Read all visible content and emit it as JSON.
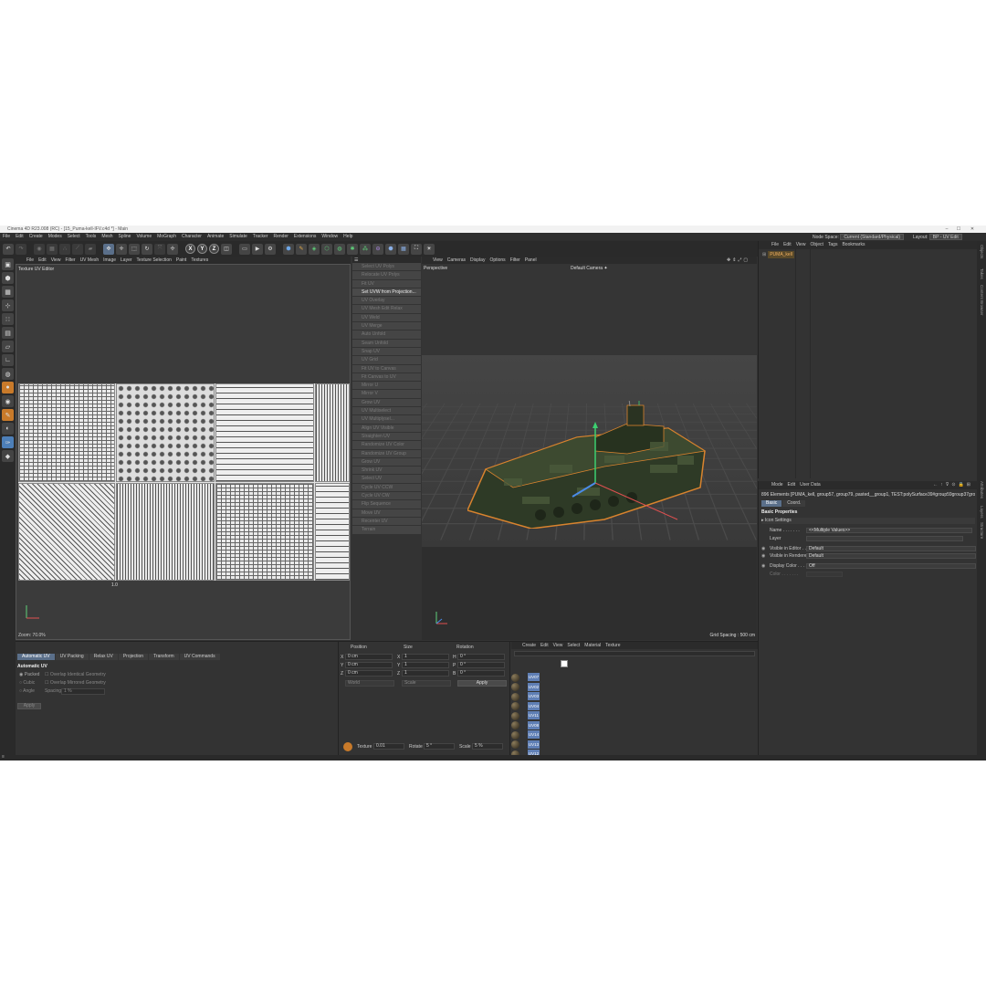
{
  "title": "Cinema 4D R23.008 (RC) - [15_Puma-kell-IFV.c4d *] - Main",
  "window_controls": [
    "–",
    "☐",
    "✕"
  ],
  "menu": [
    "File",
    "Edit",
    "Create",
    "Modes",
    "Select",
    "Tools",
    "Mesh",
    "Spline",
    "Volume",
    "MoGraph",
    "Character",
    "Animate",
    "Simulate",
    "Tracker",
    "Render",
    "Extensions",
    "Window",
    "Help"
  ],
  "node_space_label": "Node Space:",
  "node_space_value": "Current (Standard/Physical)",
  "layout_label": "Layout:",
  "layout_value": "BP - UV Edit",
  "uv_menu": [
    "File",
    "Edit",
    "View",
    "Filter",
    "UV Mesh",
    "Image",
    "Layer",
    "Texture Selection",
    "Paint",
    "Textures"
  ],
  "uv_title": "Texture UV Editor",
  "uv_zoom": "Zoom: 70.0%",
  "uv_one": "1.0",
  "uv_commands": [
    "Select UV Polys",
    "Relocate UV Polys",
    "Fit UV",
    "Set UVW from Projection...",
    "UV Overlay",
    "UV Mesh Edit Relax",
    "UV Weld",
    "UV Merge",
    "Auto Unfold",
    "Seam Unfold",
    "Snap UV",
    "UV Grid",
    "Fit UV to Canvas",
    "Fit Canvas to UV",
    "Mirror U",
    "Mirror V",
    "Grow UV",
    "UV Multiselect",
    "UV Multiplysel...",
    "Align UV Visible",
    "Straighten UV",
    "Randomize UV Color",
    "Randomize UV Group",
    "Grow UV",
    "Shrink UV",
    "Select UV",
    "Cycle UV CCW",
    "Cycle UV CW",
    "Flip Sequence",
    "Move UV",
    "Recenter UV",
    "Terrain"
  ],
  "uv_commands_active_index": 3,
  "viewport_menu": [
    "View",
    "Cameras",
    "Display",
    "Options",
    "Filter",
    "Panel"
  ],
  "viewport_label": "Perspective",
  "camera_label": "Default Camera ✦",
  "grid_spacing": "Grid Spacing : 500 cm",
  "objects_menu": [
    "File",
    "Edit",
    "View",
    "Object",
    "Tags",
    "Bookmarks"
  ],
  "object_name": "PUMA_kell",
  "side_tabs": [
    "Objects",
    "Takes",
    "Content Browser"
  ],
  "side_tabs_lower": [
    "Attributes",
    "Layers",
    "Structure"
  ],
  "attr_menu": [
    "Mode",
    "Edit",
    "User Data"
  ],
  "attr_elements": "896 Elements [PUMA_kell, group57, group79, pasted__group1, TEST:polySurface39#group59group37group16...",
  "attr_tabs": [
    "Basic",
    "Coord."
  ],
  "basic_properties": "Basic Properties",
  "icon_settings": "▸ Icon Settings",
  "attr_rows": [
    {
      "label": "Name . . . . . . .",
      "value": "<<Multiple Values>>"
    },
    {
      "label": "Layer",
      "value": ""
    },
    {
      "label": "Visible in Editor . .",
      "value": "Default"
    },
    {
      "label": "Visible in Renderer",
      "value": "Default"
    },
    {
      "label": "Display Color . . . .",
      "value": "Off"
    },
    {
      "label": "Color . . . . . . .",
      "value": ""
    }
  ],
  "bottom_tabs": [
    "Automatic UV",
    "UV Packing",
    "Relax UV",
    "Projection",
    "Transform",
    "UV Commands"
  ],
  "auto_uv_title": "Automatic UV",
  "auto_uv_opts": [
    "Packed",
    "Cubic",
    "Angle"
  ],
  "auto_uv_checks": [
    "Overlap Identical Geometry",
    "Overlap Mirrored Geometry"
  ],
  "spacing_label": "Spacing",
  "spacing_value": "1 %",
  "apply_label": "Apply",
  "coord_headers": [
    "Position",
    "Size",
    "Rotation"
  ],
  "coord_rows": [
    {
      "axis": "X",
      "pos": "0 cm",
      "size": "1",
      "rot_axis": "H",
      "rot": "0 °"
    },
    {
      "axis": "Y",
      "pos": "0 cm",
      "size": "1",
      "rot_axis": "P",
      "rot": "0 °"
    },
    {
      "axis": "Z",
      "pos": "0 cm",
      "size": "1",
      "rot_axis": "B",
      "rot": "0 °"
    }
  ],
  "coord_dropdowns": [
    "World",
    "Scale"
  ],
  "coord_apply": "Apply",
  "texture_label": "Texture",
  "texture_value": "0.01",
  "rotate_label": "Rotate",
  "rotate_value": "5 °",
  "scale_label": "Scale",
  "scale_value": "5 %",
  "material_menu": [
    "Create",
    "Edit",
    "View",
    "Select",
    "Material",
    "Texture"
  ],
  "materials": [
    "UV07",
    "UV02",
    "UV03",
    "UV04",
    "UV11",
    "UV08",
    "UV14",
    "UV13",
    "UV12"
  ],
  "colors": {
    "accent": "#5a6f8a",
    "tank_outline": "#d9832e"
  }
}
